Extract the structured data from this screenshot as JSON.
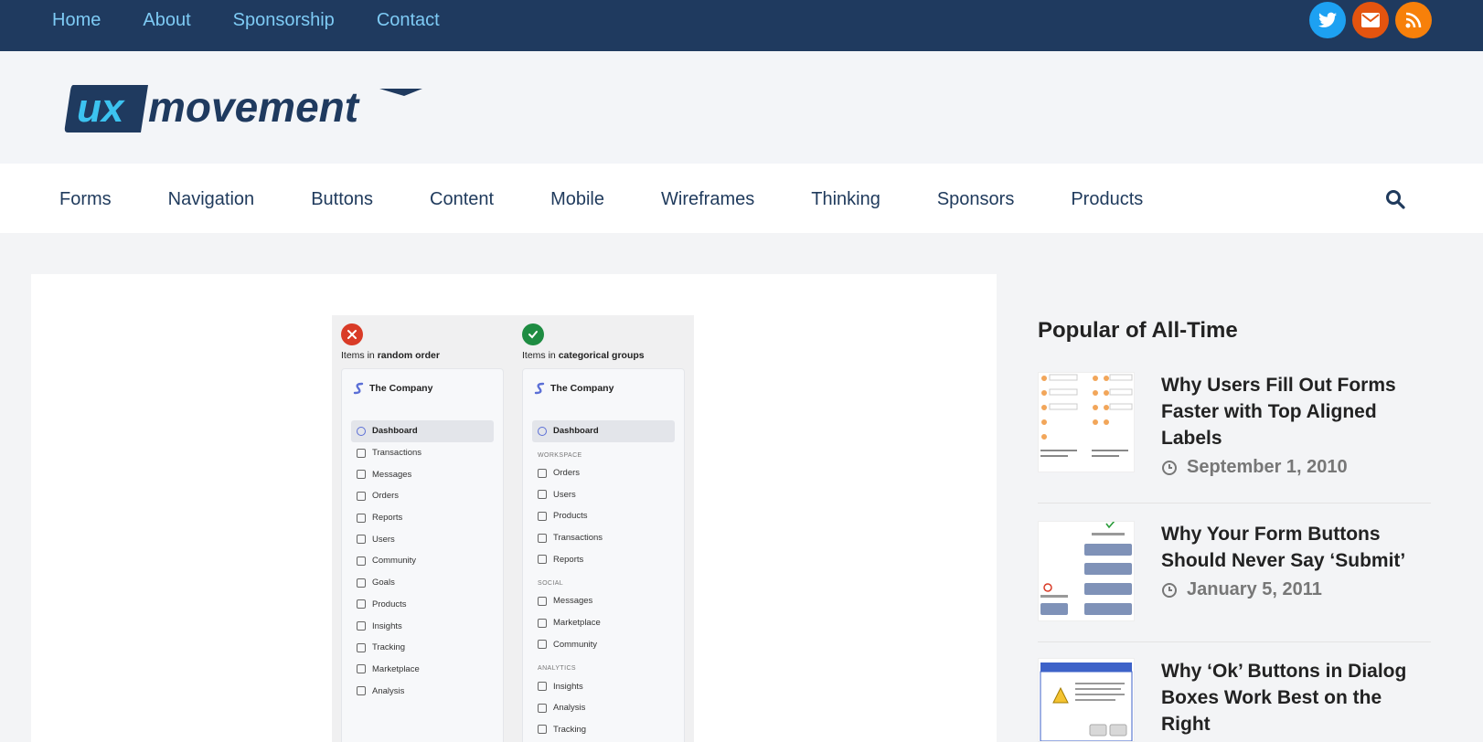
{
  "topnav": {
    "items": [
      "Home",
      "About",
      "Sponsorship",
      "Contact"
    ]
  },
  "social": {
    "icons": [
      "twitter-icon",
      "envelope-icon",
      "rss-icon"
    ],
    "colors": {
      "twitter": "#1da1f2",
      "email": "#e4540f",
      "rss": "#f7800a"
    }
  },
  "logo": {
    "mark": "ux",
    "word": "movement",
    "colors": {
      "badge": "#1f3a5f",
      "mark": "#3cc3f0",
      "word": "#1f3a5f"
    }
  },
  "catnav": {
    "items": [
      "Forms",
      "Navigation",
      "Buttons",
      "Content",
      "Mobile",
      "Wireframes",
      "Thinking",
      "Sponsors",
      "Products"
    ],
    "search_icon": "search-icon"
  },
  "figure": {
    "left": {
      "caption_prefix": "Items in ",
      "caption_bold": "random order",
      "company": "The Company",
      "menu": [
        "Dashboard",
        "Transactions",
        "Messages",
        "Orders",
        "Reports",
        "Users",
        "Community",
        "Goals",
        "Products",
        "Insights",
        "Tracking",
        "Marketplace",
        "Analysis"
      ]
    },
    "right": {
      "caption_prefix": "Items in ",
      "caption_bold": "categorical groups",
      "company": "The Company",
      "dashboard": "Dashboard",
      "groups": [
        {
          "label": "WORKSPACE",
          "items": [
            "Orders",
            "Users",
            "Products",
            "Transactions",
            "Reports"
          ]
        },
        {
          "label": "SOCIAL",
          "items": [
            "Messages",
            "Marketplace",
            "Community"
          ]
        },
        {
          "label": "ANALYTICS",
          "items": [
            "Insights",
            "Analysis",
            "Tracking"
          ]
        }
      ]
    }
  },
  "sidebar": {
    "title": "Popular of All-Time",
    "posts": [
      {
        "title": "Why Users Fill Out Forms Faster with Top Aligned Labels",
        "date": "September 1, 2010"
      },
      {
        "title": "Why Your Form Buttons Should Never Say ‘Submit’",
        "date": "January 5, 2011"
      },
      {
        "title": "Why ‘Ok’ Buttons in Dialog Boxes Work Best on the Right",
        "date": ""
      }
    ]
  }
}
